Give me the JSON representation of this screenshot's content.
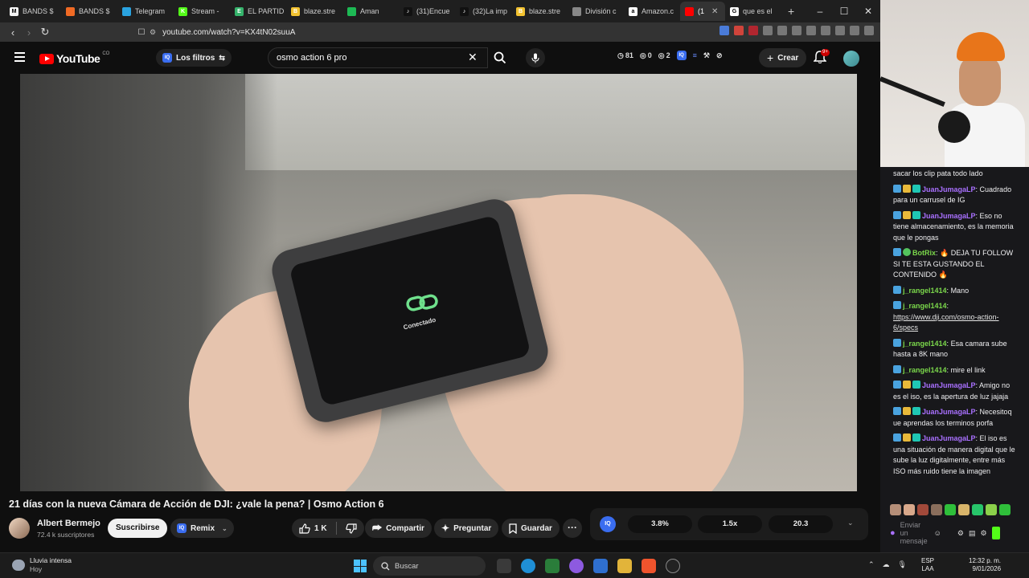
{
  "browser": {
    "tabs": [
      {
        "label": "BANDS $",
        "color": "#f5f5f5",
        "glyph": "M"
      },
      {
        "label": "BANDS $",
        "color": "#f06a24",
        "glyph": ""
      },
      {
        "label": "Telegram",
        "color": "#2aa3e0",
        "glyph": ""
      },
      {
        "label": "Stream -",
        "color": "#53fc18",
        "glyph": "K"
      },
      {
        "label": "EL PARTID",
        "color": "#35b36b",
        "glyph": "E"
      },
      {
        "label": "blaze.stre",
        "color": "#f2c230",
        "glyph": "B"
      },
      {
        "label": "Aman",
        "color": "#1db954",
        "glyph": ""
      },
      {
        "label": "(31)Encue",
        "color": "#111111",
        "glyph": "♪"
      },
      {
        "label": "(32)La imp",
        "color": "#111111",
        "glyph": "♪"
      },
      {
        "label": "blaze.stre",
        "color": "#f2c230",
        "glyph": "B"
      },
      {
        "label": "División c",
        "color": "#888888",
        "glyph": ""
      },
      {
        "label": "Amazon.c",
        "color": "#ffffff",
        "glyph": "a"
      },
      {
        "label": "(1",
        "color": "#ff0000",
        "glyph": "",
        "active": true
      },
      {
        "label": "que es el",
        "color": "#ffffff",
        "glyph": "G"
      }
    ],
    "url": "youtube.com/watch?v=KX4tN02suuA"
  },
  "youtube": {
    "logo_text": "YouTube",
    "country_code": "CO",
    "filters_label": "Los filtros",
    "search_value": "osmo action 6 pro",
    "stats": {
      "a": "81",
      "b": "0",
      "c": "2"
    },
    "create_label": "Crear",
    "notifications_badge": "9+"
  },
  "video": {
    "screen_text": "Conectado",
    "title": "21 días con la nueva Cámara de Acción de DJI: ¿vale la pena? | Osmo Action 6",
    "channel_name": "Albert Bermejo",
    "subscribers": "72.4 k suscriptores",
    "subscribe_label": "Suscribirse",
    "remix_label": "Remix",
    "like_count": "1 K",
    "share_label": "Compartir",
    "ask_label": "Preguntar",
    "save_label": "Guardar",
    "iq_label": "IQ",
    "iq_stats": [
      "3.8%",
      "1.5x",
      "20.3"
    ]
  },
  "chat": {
    "messages": [
      {
        "user": "",
        "text": "sacar los clip pata todo lado",
        "color": "",
        "badges": []
      },
      {
        "user": "JuanJumagaLP",
        "text": "Cuadrado para un carrusel de IG",
        "color": "#a970ff",
        "badges": [
          "blue",
          "crown",
          "teal"
        ]
      },
      {
        "user": "JuanJumagaLP",
        "text": "Eso no tiene almacenamiento, es la memoria que le pongas",
        "color": "#a970ff",
        "badges": [
          "blue",
          "crown",
          "teal"
        ]
      },
      {
        "user": "BotRix",
        "text": "🔥 DEJA TU FOLLOW SI TE ESTA GUSTANDO EL CONTENIDO 🔥",
        "color": "#7bd84b",
        "badges": [
          "blue",
          "green"
        ]
      },
      {
        "user": "j_rangel1414",
        "text": "Mano",
        "color": "#7bd84b",
        "badges": [
          "blue"
        ]
      },
      {
        "user": "j_rangel1414",
        "text": "",
        "link": "https://www.dji.com/osmo-action-6/specs",
        "color": "#7bd84b",
        "badges": [
          "blue"
        ]
      },
      {
        "user": "j_rangel1414",
        "text": "Esa camara sube hasta a 8K mano",
        "color": "#7bd84b",
        "badges": [
          "blue"
        ]
      },
      {
        "user": "j_rangel1414",
        "text": "mire el link",
        "color": "#7bd84b",
        "badges": [
          "blue"
        ]
      },
      {
        "user": "JuanJumagaLP",
        "text": "Amigo no es el iso, es la apertura de luz jajaja",
        "color": "#a970ff",
        "badges": [
          "blue",
          "crown",
          "teal"
        ]
      },
      {
        "user": "JuanJumagaLP",
        "text": "Necesitoq ue aprendas los terminos porfa",
        "color": "#a970ff",
        "badges": [
          "blue",
          "crown",
          "teal"
        ]
      },
      {
        "user": "JuanJumagaLP",
        "text": "El iso es una situación de manera digital que le sube la luz digitalmente, entre más ISO más ruido tiene la imagen",
        "color": "#a970ff",
        "badges": [
          "blue",
          "crown",
          "teal"
        ]
      }
    ],
    "input_placeholder": "Enviar un mensaje"
  },
  "taskbar": {
    "weather_title": "Lluvia intensa",
    "weather_sub": "Hoy",
    "search_placeholder": "Buscar",
    "lang_top": "ESP",
    "lang_bottom": "LAA",
    "time": "12:32 p. m.",
    "date": "9/01/2026"
  }
}
